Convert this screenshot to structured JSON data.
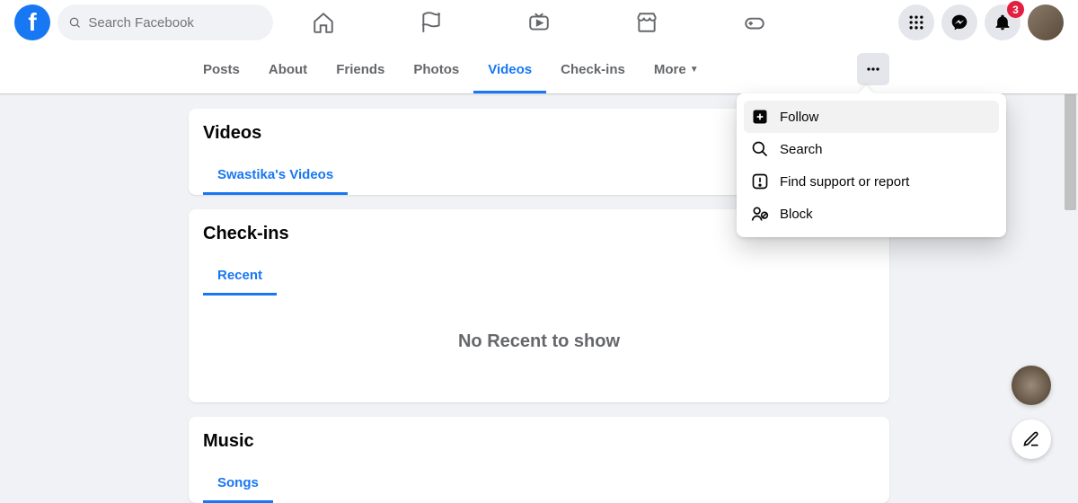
{
  "search": {
    "placeholder": "Search Facebook"
  },
  "notifications": {
    "count": "3"
  },
  "profile_tabs": {
    "posts": "Posts",
    "about": "About",
    "friends": "Friends",
    "photos": "Photos",
    "videos": "Videos",
    "checkins": "Check-ins",
    "more": "More"
  },
  "dropdown": {
    "follow": "Follow",
    "search": "Search",
    "report": "Find support or report",
    "block": "Block"
  },
  "sections": {
    "videos": {
      "title": "Videos",
      "subtab": "Swastika's Videos"
    },
    "checkins": {
      "title": "Check-ins",
      "subtab": "Recent",
      "empty": "No Recent to show"
    },
    "music": {
      "title": "Music",
      "subtab": "Songs"
    }
  }
}
